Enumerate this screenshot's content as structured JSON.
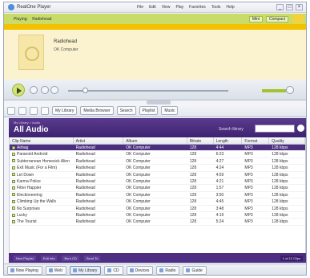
{
  "window": {
    "title": "RealOne Player",
    "menu": [
      "File",
      "Edit",
      "View",
      "Play",
      "Favorites",
      "Tools",
      "Help"
    ],
    "controls": [
      "_",
      "□",
      "×"
    ]
  },
  "now_playing": {
    "label": "Playing:",
    "track": "Radiohead",
    "mini_buttons": [
      "Mini",
      "Compact"
    ]
  },
  "info": {
    "artist": "Radiohead",
    "album": "OK Computer"
  },
  "nav": {
    "tabs": [
      "My Library",
      "Media Browser",
      "Search",
      "Playlist",
      "Music"
    ]
  },
  "library": {
    "breadcrumb": "My Library > Audio",
    "heading": "All Audio",
    "search_label": "Search library",
    "search_value": ""
  },
  "table": {
    "columns": [
      "Clip Name",
      "Artist",
      "Album",
      "Bitrate",
      "Length",
      "Format",
      "Quality"
    ],
    "rows": [
      [
        "Airbag",
        "Radiohead",
        "OK Computer",
        "128",
        "4:44",
        "MP3",
        "128 kbps"
      ],
      [
        "Paranoid Android",
        "Radiohead",
        "OK Computer",
        "128",
        "6:23",
        "MP3",
        "128 kbps"
      ],
      [
        "Subterranean Homesick Alien",
        "Radiohead",
        "OK Computer",
        "128",
        "4:27",
        "MP3",
        "128 kbps"
      ],
      [
        "Exit Music (For a Film)",
        "Radiohead",
        "OK Computer",
        "128",
        "4:24",
        "MP3",
        "128 kbps"
      ],
      [
        "Let Down",
        "Radiohead",
        "OK Computer",
        "128",
        "4:59",
        "MP3",
        "128 kbps"
      ],
      [
        "Karma Police",
        "Radiohead",
        "OK Computer",
        "128",
        "4:21",
        "MP3",
        "128 kbps"
      ],
      [
        "Fitter Happier",
        "Radiohead",
        "OK Computer",
        "128",
        "1:57",
        "MP3",
        "128 kbps"
      ],
      [
        "Electioneering",
        "Radiohead",
        "OK Computer",
        "128",
        "3:50",
        "MP3",
        "128 kbps"
      ],
      [
        "Climbing Up the Walls",
        "Radiohead",
        "OK Computer",
        "128",
        "4:45",
        "MP3",
        "128 kbps"
      ],
      [
        "No Surprises",
        "Radiohead",
        "OK Computer",
        "128",
        "3:48",
        "MP3",
        "128 kbps"
      ],
      [
        "Lucky",
        "Radiohead",
        "OK Computer",
        "128",
        "4:19",
        "MP3",
        "128 kbps"
      ],
      [
        "The Tourist",
        "Radiohead",
        "OK Computer",
        "128",
        "5:24",
        "MP3",
        "128 kbps"
      ]
    ]
  },
  "status": {
    "buttons": [
      "New Playlist",
      "Edit Info",
      "Burn CD",
      "Send To"
    ],
    "meta": "1 of 12 Clips"
  },
  "bottom_tabs": [
    "Now Playing",
    "Web",
    "My Library",
    "CD",
    "Devices",
    "Radio",
    "Guide"
  ],
  "colors": {
    "accent_green": "#c9dc6a",
    "library_purple": "#4c2f7f",
    "info_yellow": "#f2c200"
  }
}
